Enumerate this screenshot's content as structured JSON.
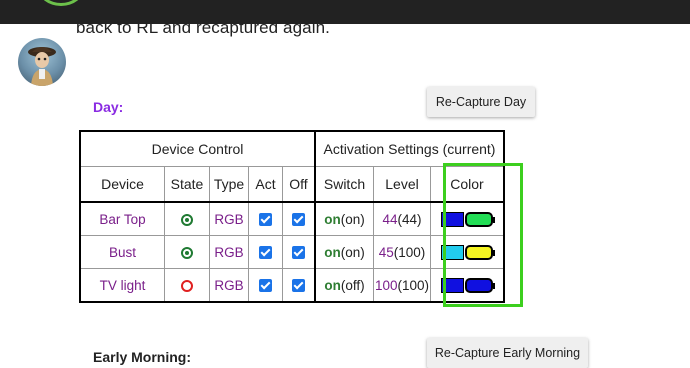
{
  "post": {
    "text": "back to RL and recaptured again."
  },
  "day_section": {
    "label": "Day:",
    "recapture_label": "Re-Capture Day"
  },
  "early_section": {
    "label": "Early Morning:",
    "recapture_label": "Re-Capture Early Morning"
  },
  "table": {
    "group_headers": [
      "Device Control",
      "Activation Settings (current)"
    ],
    "columns": [
      "Device",
      "State",
      "Type",
      "Act",
      "Off",
      "Switch",
      "Level",
      "Color"
    ],
    "rows": [
      {
        "device": "Bar Top",
        "state": "on",
        "type": "RGB",
        "act": true,
        "off": true,
        "switch_main": "on",
        "switch_current": "(on)",
        "level_main": "44",
        "level_current": "(44)",
        "swatch_color": "#1010e0",
        "current_color": "#22dd55"
      },
      {
        "device": "Bust",
        "state": "on",
        "type": "RGB",
        "act": true,
        "off": true,
        "switch_main": "on",
        "switch_current": "(on)",
        "level_main": "45",
        "level_current": "(100)",
        "swatch_color": "#22ccee",
        "current_color": "#f5f522"
      },
      {
        "device": "TV light",
        "state": "off",
        "type": "RGB",
        "act": true,
        "off": true,
        "switch_main": "on",
        "switch_current": "(off)",
        "level_main": "100",
        "level_current": "(100)",
        "swatch_color": "#1010e0",
        "current_color": "#1010e0"
      }
    ]
  },
  "colors": {
    "topbar": "#222222",
    "day_label": "#8a2be2",
    "device_text": "#7a1f8a",
    "on_text": "#2e7d32",
    "state_on": "#1f7a32",
    "state_off": "#e02020",
    "checkbox": "#1a73e8",
    "highlight": "#3ccf1e"
  },
  "icons": {
    "state_on": "radio-checked-icon",
    "state_off": "radio-unchecked-icon",
    "act": "checkbox-checked-icon",
    "off": "checkbox-checked-icon",
    "current_color": "battery-color-icon"
  }
}
